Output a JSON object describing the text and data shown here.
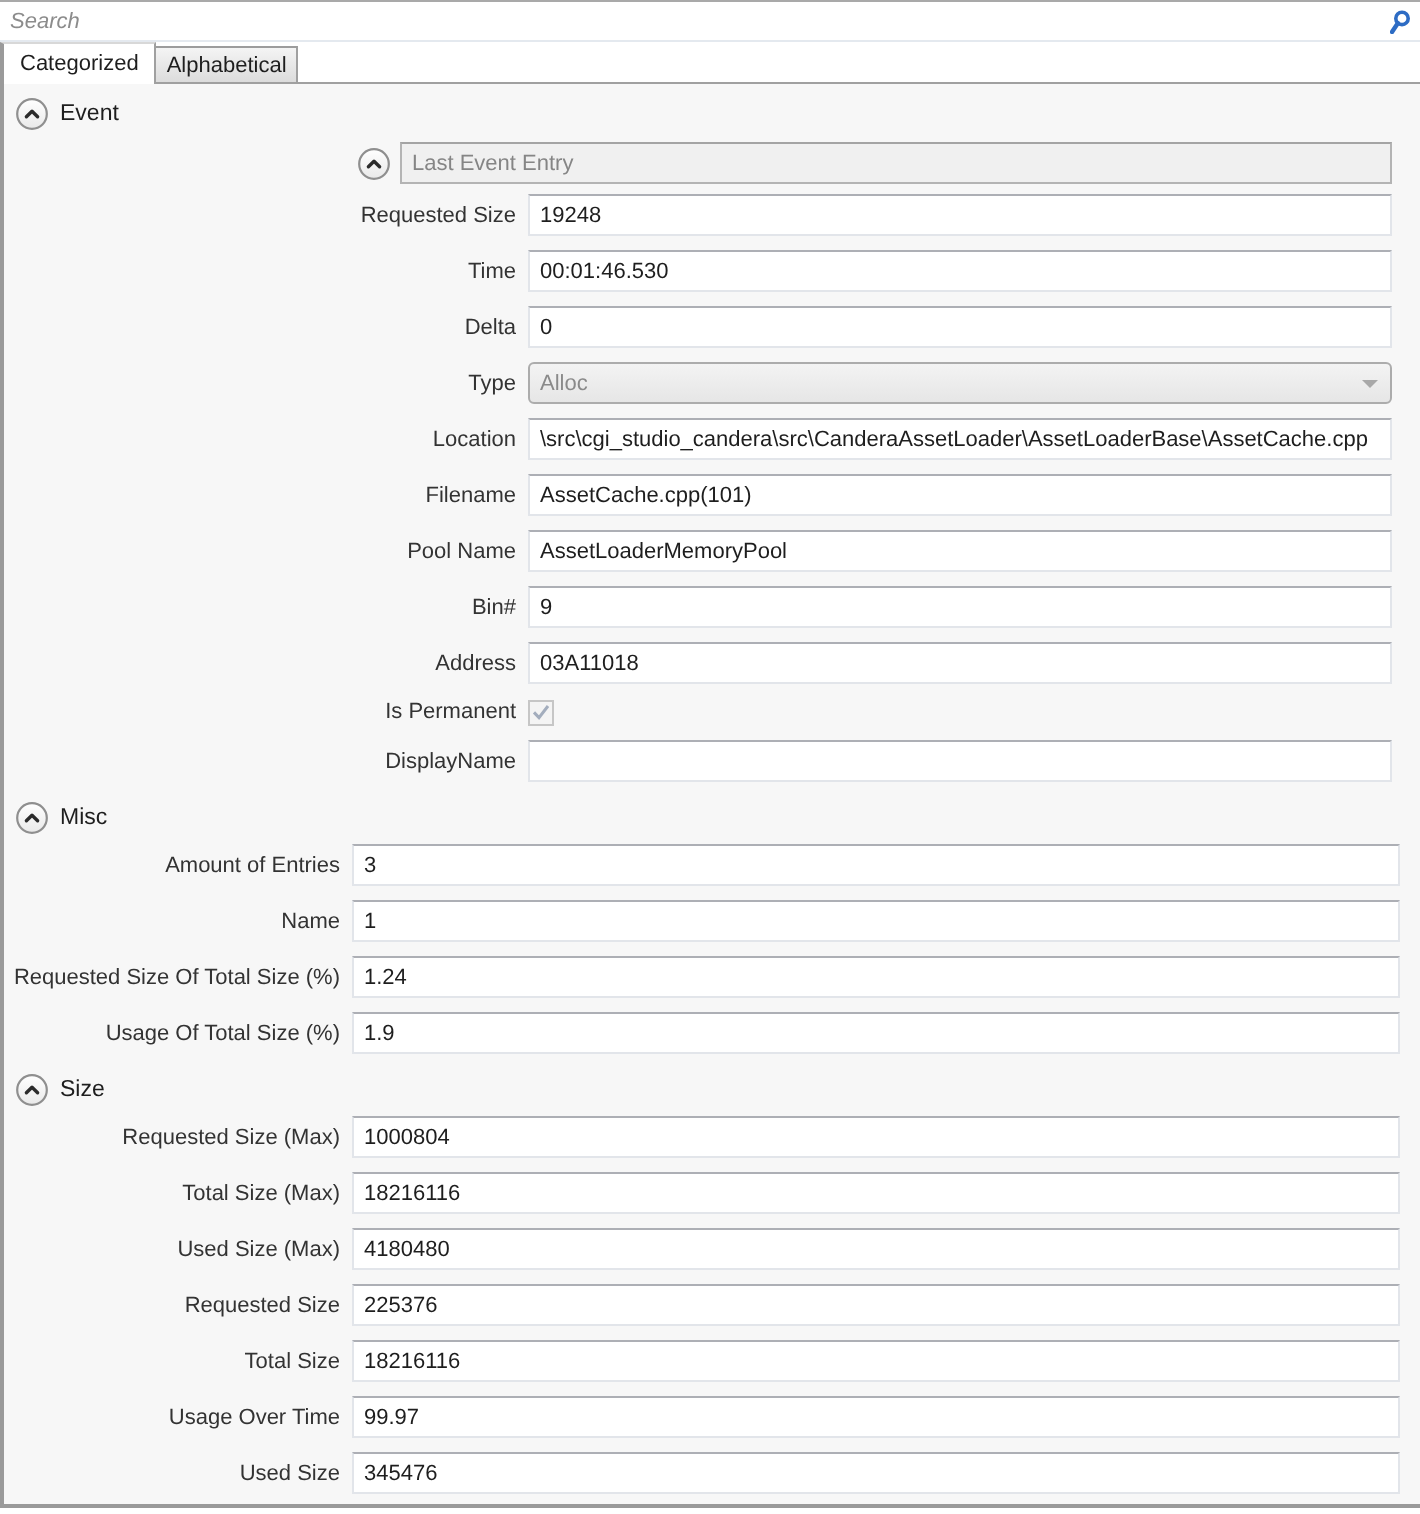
{
  "search": {
    "placeholder": "Search"
  },
  "tabs": [
    {
      "label": "Categorized",
      "selected": true
    },
    {
      "label": "Alphabetical",
      "selected": false
    }
  ],
  "sections": [
    {
      "title": "Event",
      "expanded": true,
      "entry": {
        "title": "Last Event Entry",
        "expanded": true,
        "disabled": true,
        "properties": [
          {
            "kind": "text",
            "label": "Requested Size",
            "value": "19248",
            "disabled": false
          },
          {
            "kind": "text",
            "label": "Time",
            "value": "00:01:46.530",
            "disabled": false
          },
          {
            "kind": "text",
            "label": "Delta",
            "value": "0",
            "disabled": false
          },
          {
            "kind": "combo",
            "label": "Type",
            "value": "Alloc",
            "disabled": true
          },
          {
            "kind": "text",
            "label": "Location",
            "value": "\\src\\cgi_studio_candera\\src\\CanderaAssetLoader\\AssetLoaderBase\\AssetCache.cpp",
            "disabled": false
          },
          {
            "kind": "text",
            "label": "Filename",
            "value": "AssetCache.cpp(101)",
            "disabled": false
          },
          {
            "kind": "text",
            "label": "Pool Name",
            "value": "AssetLoaderMemoryPool",
            "disabled": false
          },
          {
            "kind": "text",
            "label": "Bin#",
            "value": "9",
            "disabled": false
          },
          {
            "kind": "text",
            "label": "Address",
            "value": "03A11018",
            "disabled": false
          },
          {
            "kind": "checkbox",
            "label": "Is Permanent",
            "checked": true,
            "disabled": true
          },
          {
            "kind": "text",
            "label": "DisplayName",
            "disabled": false
          }
        ]
      }
    },
    {
      "title": "Misc",
      "expanded": true,
      "properties": [
        {
          "kind": "text",
          "label": "Amount of Entries",
          "value": "3"
        },
        {
          "kind": "text",
          "label": "Name",
          "value": "1"
        },
        {
          "kind": "text",
          "label": "Requested Size Of Total Size (%)",
          "value": "1.24"
        },
        {
          "kind": "text",
          "label": "Usage Of Total Size (%)",
          "value": "1.9"
        }
      ]
    },
    {
      "title": "Size",
      "expanded": true,
      "properties": [
        {
          "kind": "text",
          "label": "Requested Size (Max)",
          "value": "1000804"
        },
        {
          "kind": "text",
          "label": "Total Size (Max)",
          "value": "18216116"
        },
        {
          "kind": "text",
          "label": "Used Size (Max)",
          "value": "4180480"
        },
        {
          "kind": "text",
          "label": "Requested Size",
          "value": "225376"
        },
        {
          "kind": "text",
          "label": "Total Size",
          "value": "18216116"
        },
        {
          "kind": "text",
          "label": "Usage Over Time",
          "value": "99.97"
        },
        {
          "kind": "text",
          "label": "Used Size",
          "value": "345476"
        }
      ]
    }
  ]
}
